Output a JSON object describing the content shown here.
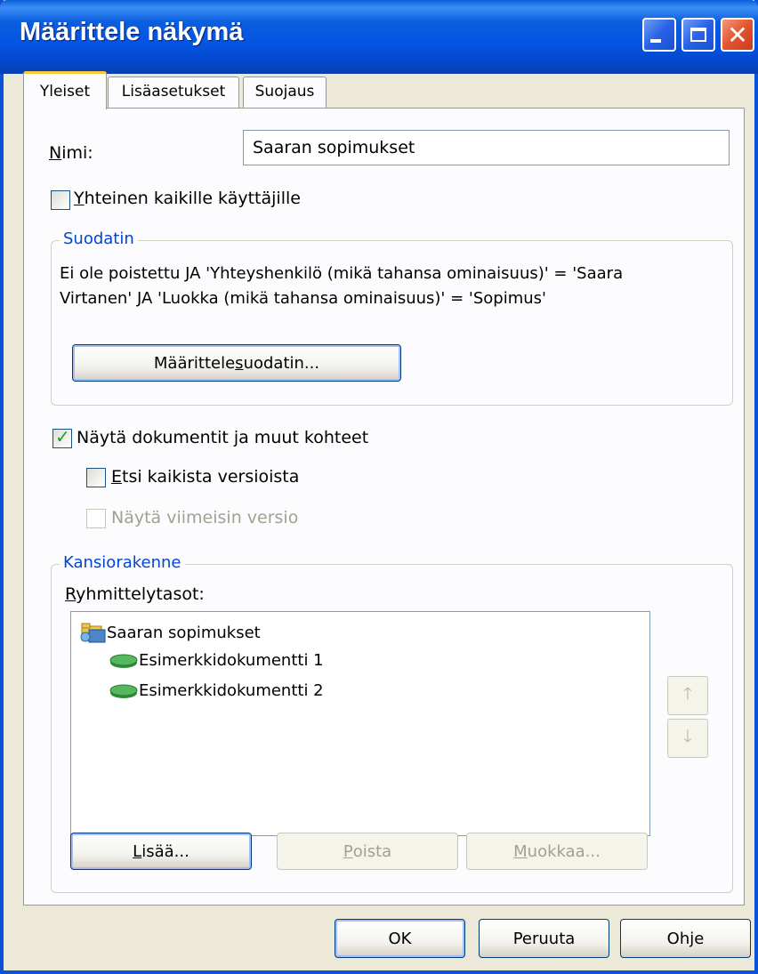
{
  "window": {
    "title": "Määrittele näkymä"
  },
  "tabs": [
    {
      "label": "Yleiset",
      "active": true
    },
    {
      "label": "Lisäasetukset",
      "active": false
    },
    {
      "label": "Suojaus",
      "active": false
    }
  ],
  "general": {
    "name_label_first": "N",
    "name_label_rest": "imi:",
    "name_value": "Saaran sopimukset",
    "shared_checkbox": {
      "label_first": "Y",
      "label_rest": "hteinen kaikille käyttäjille",
      "checked": false
    }
  },
  "filter": {
    "group_title": "Suodatin",
    "description_line1": "Ei ole poistettu JA 'Yhteyshenkilö (mikä tahansa ominaisuus)' = 'Saara",
    "description_line2": "Virtanen' JA 'Luokka (mikä tahansa ominaisuus)' = 'Sopimus'",
    "define_button_pre": "Määrittele ",
    "define_button_u": "s",
    "define_button_post": "uodatin..."
  },
  "documents": {
    "show_docs": {
      "label_pre": "Näytä dokumentit ",
      "label_u": "j",
      "label_post": "a muut kohteet",
      "checked": true
    },
    "search_versions": {
      "label_u": "E",
      "label_rest": "tsi kaikista versioista",
      "checked": false
    },
    "show_latest": {
      "label": "Näytä viimeisin versio",
      "checked": false,
      "disabled": true
    }
  },
  "folder": {
    "group_title": "Kansiorakenne",
    "levels_label_u": "R",
    "levels_label_rest": "yhmittelytasot:",
    "tree": [
      {
        "label": "Saaran sopimukset",
        "icon": "view-folder-icon",
        "level": 0
      },
      {
        "label": "Esimerkkidokumentti 1",
        "icon": "green-document-icon",
        "level": 1
      },
      {
        "label": "Esimerkkidokumentti 2",
        "icon": "green-document-icon",
        "level": 1
      }
    ],
    "add_button_u": "L",
    "add_button_rest": "isää...",
    "remove_button_u": "P",
    "remove_button_rest": "oista",
    "edit_button_u": "M",
    "edit_button_rest": "uokkaa..."
  },
  "footer": {
    "ok_label": "OK",
    "cancel_label": "Peruuta",
    "help_label": "Ohje"
  },
  "colors": {
    "titlebar": "#0454e2",
    "group_title": "#0046d5",
    "checkmark": "#21a121"
  }
}
